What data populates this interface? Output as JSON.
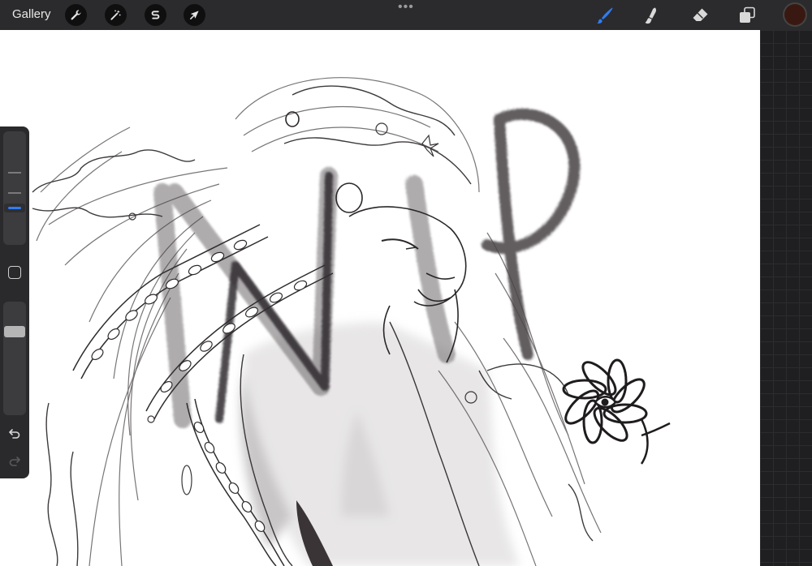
{
  "topbar": {
    "gallery_label": "Gallery",
    "actions": [
      {
        "name": "actions-wrench",
        "icon": "wrench-icon"
      },
      {
        "name": "adjustments-wand",
        "icon": "magic-wand-icon"
      },
      {
        "name": "selection",
        "icon": "selection-s-icon"
      },
      {
        "name": "transform",
        "icon": "transform-arrow-icon"
      }
    ],
    "more_label": "•••",
    "right_tools": [
      {
        "name": "brush",
        "icon": "brush-icon",
        "active": true
      },
      {
        "name": "smudge",
        "icon": "smudge-icon",
        "active": false
      },
      {
        "name": "eraser",
        "icon": "eraser-icon",
        "active": false
      },
      {
        "name": "layers",
        "icon": "layers-icon",
        "active": false
      }
    ],
    "current_color": "#3a1812",
    "active_color": "#2f7cf6"
  },
  "sidebar": {
    "brush_size_level": 0.31,
    "brush_opacity_level": 0.76
  },
  "canvas": {
    "background": "#ffffff",
    "ink": "#2d2a2c"
  }
}
